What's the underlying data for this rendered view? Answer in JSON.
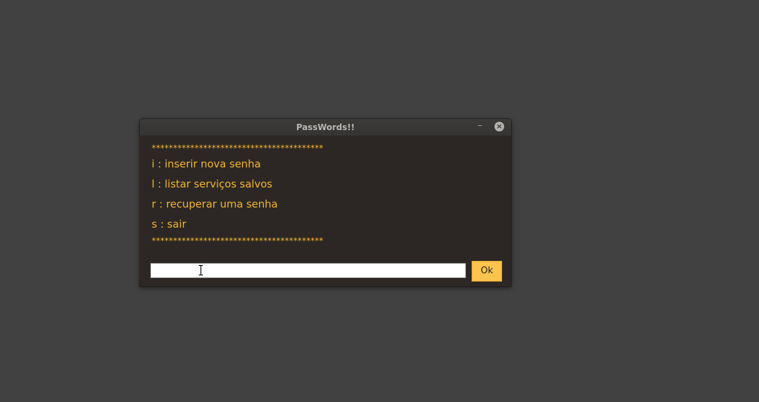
{
  "window": {
    "title": "PassWords!!",
    "minimize_symbol": "–",
    "close_symbol": "×"
  },
  "menu": {
    "border_top": "****************************************",
    "items": [
      {
        "label": "i : inserir nova senha"
      },
      {
        "label": "l : listar serviços salvos"
      },
      {
        "label": "r : recuperar uma senha"
      },
      {
        "label": "s : sair"
      }
    ],
    "border_bottom": "****************************************"
  },
  "command": {
    "input_value": "",
    "ok_label": "Ok"
  },
  "colors": {
    "desktop": "#414141",
    "window_bg": "#2c2724",
    "accent_text": "#f3b52f",
    "ok_button": "#fcc44e"
  },
  "icons": {
    "minimize": "minimize-icon",
    "close": "close-icon",
    "cursor": "text-cursor-icon"
  }
}
